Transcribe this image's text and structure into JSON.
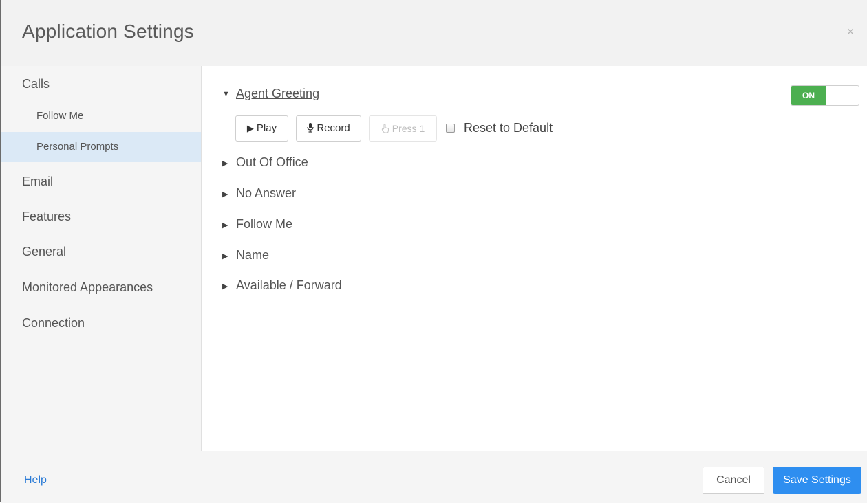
{
  "dialog": {
    "title": "Application Settings",
    "close_glyph": "×"
  },
  "sidebar": {
    "items": [
      {
        "label": "Calls"
      },
      {
        "label": "Follow Me"
      },
      {
        "label": "Personal Prompts"
      },
      {
        "label": "Email"
      },
      {
        "label": "Features"
      },
      {
        "label": "General"
      },
      {
        "label": "Monitored Appearances"
      },
      {
        "label": "Connection"
      }
    ]
  },
  "main": {
    "expanded_section": {
      "label": "Agent Greeting",
      "caret": "▼",
      "toggle": {
        "label": "ON",
        "state": "on",
        "color": "#4caf50"
      },
      "play_label": "Play",
      "play_icon": "play-icon",
      "record_label": "Record",
      "record_icon": "microphone-icon",
      "press1_label": "Press 1",
      "press1_icon": "hand-pointer-icon",
      "reset_label": "Reset to Default",
      "reset_checked": false
    },
    "sections": [
      {
        "label": "Out Of Office",
        "caret": "▶"
      },
      {
        "label": "No Answer",
        "caret": "▶"
      },
      {
        "label": "Follow Me",
        "caret": "▶"
      },
      {
        "label": "Name",
        "caret": "▶"
      },
      {
        "label": "Available / Forward",
        "caret": "▶"
      }
    ]
  },
  "footer": {
    "help_label": "Help",
    "cancel_label": "Cancel",
    "save_label": "Save Settings",
    "save_color": "#2e8ef0",
    "help_color": "#2b7bd6"
  }
}
